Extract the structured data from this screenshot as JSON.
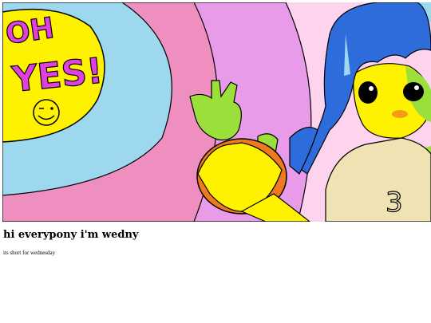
{
  "post": {
    "title": "hi everypony i'm wedny",
    "subtitle": "its short for wednesday"
  },
  "illustration": {
    "speech_bubble_text": "OH YES!",
    "palette": {
      "outline": "#000000",
      "sky_blue": "#9ed8ee",
      "rose": "#ee8fbf",
      "violet": "#e79be9",
      "pale_pink": "#fdd3ee",
      "yellow": "#fff200",
      "magenta_text": "#e040e0",
      "lime": "#9be03a",
      "orange": "#f0781e",
      "hair_blue": "#2f6cdb",
      "shirt": "#efe3b3"
    },
    "icons": [
      "winking-smiley-icon"
    ]
  }
}
